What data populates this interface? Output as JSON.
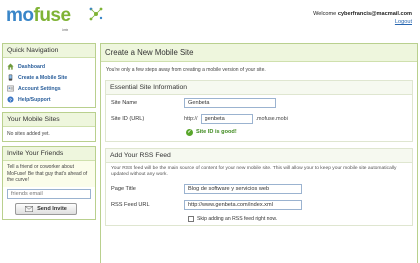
{
  "header": {
    "logo": {
      "mo": "mo",
      "fuse": "fuse",
      "beta": "beta"
    },
    "welcome_prefix": "Welcome ",
    "user_email": "cyberfrancis@macmail.com",
    "logout": "Logout"
  },
  "sidebar": {
    "quick_nav": {
      "title": "Quick Navigation",
      "items": [
        {
          "label": "Dashboard",
          "icon": "home-icon"
        },
        {
          "label": "Create a Mobile Site",
          "icon": "phone-icon"
        },
        {
          "label": "Account Settings",
          "icon": "account-icon"
        },
        {
          "label": "Help/Support",
          "icon": "help-icon"
        }
      ]
    },
    "mobile_sites": {
      "title": "Your Mobile Sites",
      "empty_text": "No sites added yet."
    },
    "invite": {
      "title": "Invite Your Friends",
      "text": "Tell a friend or coworker about MoFuse! Be that guy that's ahead of the curve!",
      "placeholder": "friends email",
      "button": "Send Invite"
    }
  },
  "main": {
    "title": "Create a New Mobile Site",
    "intro": "You're only a few steps away from creating a mobile version of your site.",
    "essential": {
      "title": "Essential Site Information",
      "site_name_label": "Site Name",
      "site_name_value": "Genbeta",
      "site_id_label": "Site ID (URL)",
      "site_id_prefix": "http://",
      "site_id_value": "genbeta",
      "site_id_suffix": ".mofuse.mobi",
      "status": "Site ID is good!"
    },
    "rss": {
      "title": "Add Your RSS Feed",
      "description": "Your RSS feed will be the main source of content for your new mobile site. This will allow your to keep your mobile site automatically updated without any work.",
      "page_title_label": "Page Title",
      "page_title_value": "Blog de software y servicios web",
      "feed_url_label": "RSS Feed URL",
      "feed_url_value": "http://www.genbeta.com/index.xml",
      "skip_label": "Skip adding an RSS feed right now."
    }
  },
  "colors": {
    "logo_blue": "#3a86c8",
    "logo_green": "#7fb335",
    "panel_border": "#b9d08e",
    "panel_header_bg": "#eef6dd",
    "link_blue": "#2b5f9b",
    "success_green": "#3f8a1f"
  }
}
